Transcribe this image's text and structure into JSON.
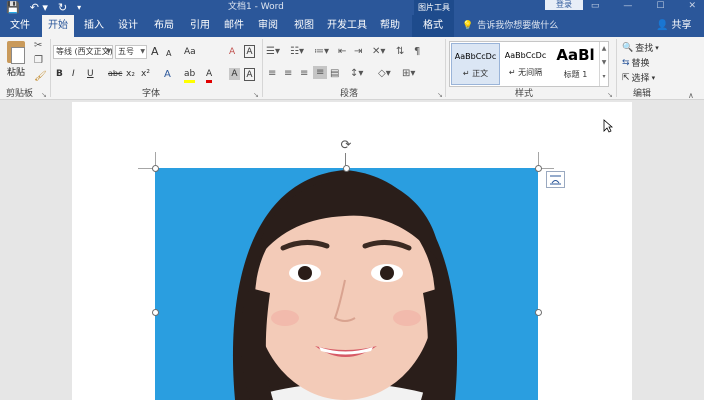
{
  "titlebar": {
    "save_icon": "save-icon",
    "undo_icon": "undo-icon",
    "doc_title": "文档1 - Word",
    "context_group": "图片工具",
    "login": "登录",
    "minimize": "—",
    "restore": "☐",
    "close": "✕"
  },
  "tabs": [
    {
      "label": "文件"
    },
    {
      "label": "开始"
    },
    {
      "label": "插入"
    },
    {
      "label": "设计"
    },
    {
      "label": "布局"
    },
    {
      "label": "引用"
    },
    {
      "label": "邮件"
    },
    {
      "label": "审阅"
    },
    {
      "label": "视图"
    },
    {
      "label": "开发工具"
    },
    {
      "label": "帮助"
    },
    {
      "label": "格式"
    }
  ],
  "active_tab": "开始",
  "tellme": {
    "placeholder": "告诉我你想要做什么"
  },
  "share": {
    "label": "共享"
  },
  "ribbon": {
    "clipboard": {
      "paste": "粘贴",
      "label": "剪贴板"
    },
    "font": {
      "name": "等线 (西文正文)",
      "size": "五号",
      "label": "字体",
      "bold": "B",
      "italic": "I",
      "underline": "U",
      "strike": "abc",
      "subscript": "x₂",
      "superscript": "x²",
      "grow": "A",
      "shrink": "A",
      "case": "Aa",
      "clear": "A",
      "highlight": "ab",
      "color": "A",
      "shade": "A",
      "border": "A"
    },
    "paragraph": {
      "label": "段落"
    },
    "styles": {
      "label": "样式",
      "items": [
        {
          "sample": "AaBbCcDc",
          "name": "↵ 正文"
        },
        {
          "sample": "AaBbCcDc",
          "name": "↵ 无间隔"
        },
        {
          "sample": "AaBl",
          "name": "标题 1"
        }
      ]
    },
    "editing": {
      "label": "编辑",
      "find": "查找",
      "replace": "替换",
      "select": "选择"
    }
  },
  "colors": {
    "brand": "#2b579a",
    "ribbon_bg": "#f3f3f3",
    "photo_bg": "#2a9ee0"
  }
}
